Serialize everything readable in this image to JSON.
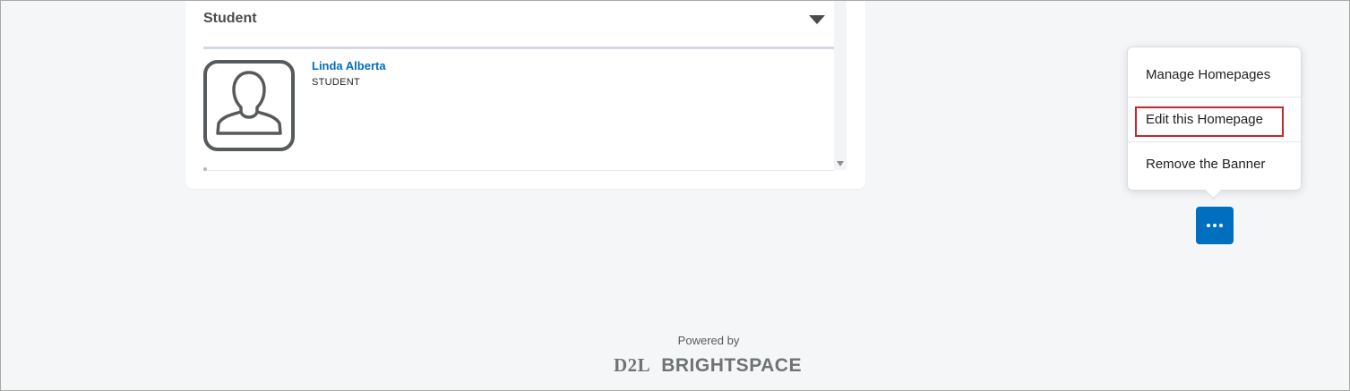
{
  "widget": {
    "title": "Student",
    "user": {
      "name": "Linda Alberta",
      "role": "STUDENT"
    }
  },
  "menu": {
    "items": [
      {
        "label": "Manage Homepages"
      },
      {
        "label": "Edit this Homepage"
      },
      {
        "label": "Remove the Banner"
      }
    ]
  },
  "footer": {
    "powered_by": "Powered by",
    "brand_d2l": "D2L",
    "brand_name": "BRIGHTSPACE"
  },
  "colors": {
    "accent": "#006fbf",
    "highlight": "#c0292e",
    "background": "#f5f6f8"
  },
  "icons": {
    "collapse": "caret-down-icon",
    "avatar": "user-silhouette-icon",
    "more": "more-horizontal-icon"
  }
}
